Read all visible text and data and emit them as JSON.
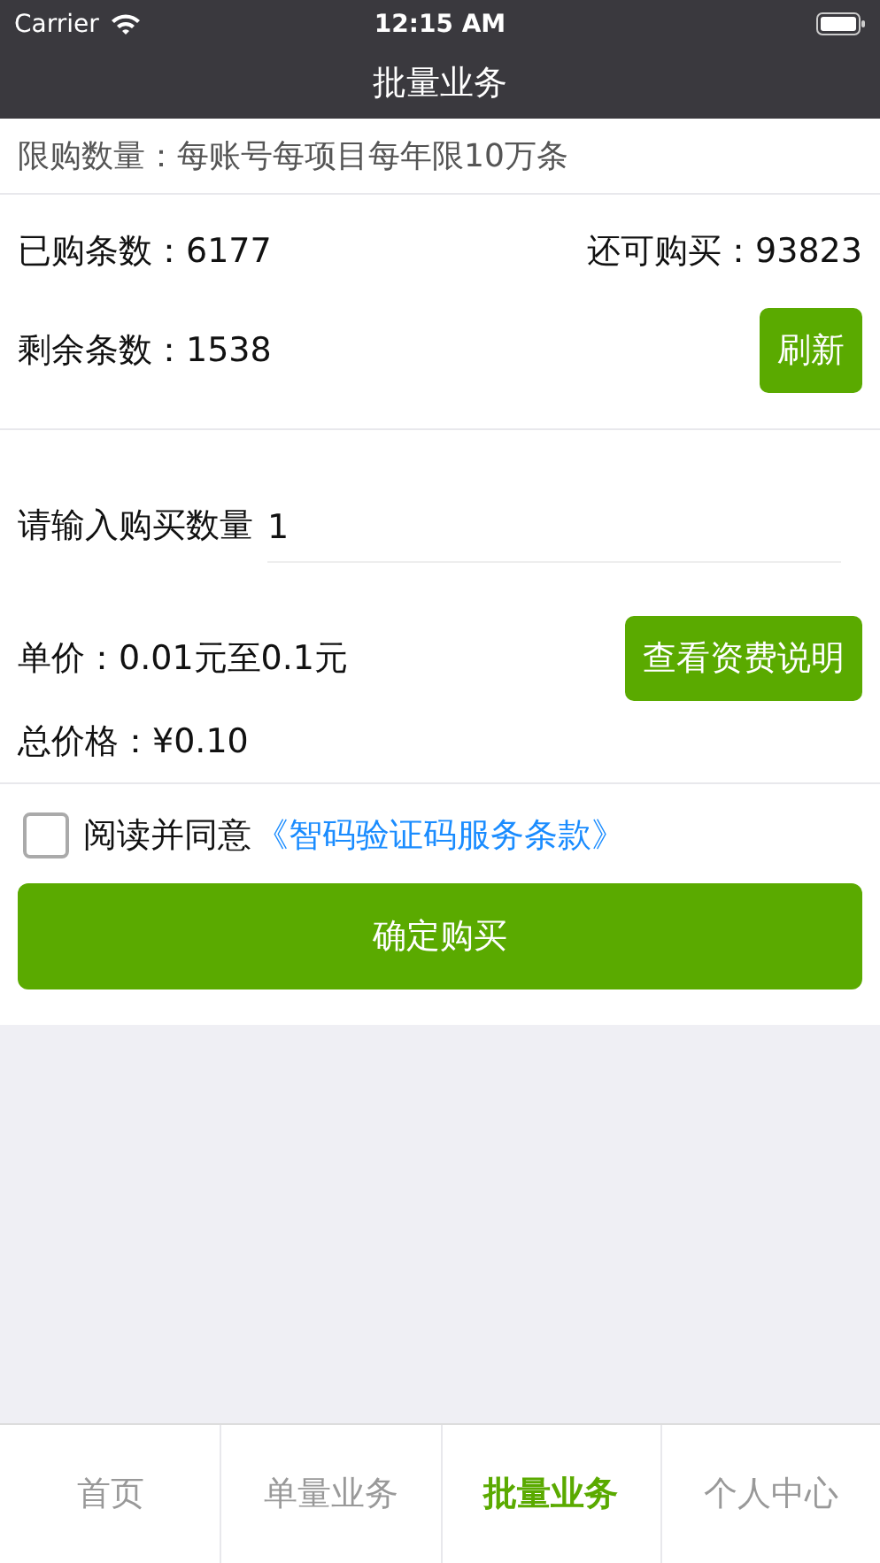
{
  "status_bar": {
    "carrier": "Carrier",
    "time": "12:15 AM"
  },
  "nav": {
    "title": "批量业务"
  },
  "limit": {
    "label": "限购数量：",
    "value": "每账号每项目每年限10万条"
  },
  "stats": {
    "purchased": {
      "label": "已购条数：",
      "value": "6177"
    },
    "available": {
      "label": "还可购买：",
      "value": "93823"
    },
    "remaining": {
      "label": "剩余条数：",
      "value": "1538"
    },
    "refresh_button": "刷新"
  },
  "quantity": {
    "label": "请输入购买数量",
    "value": "1"
  },
  "unit_price": {
    "label": "单价：",
    "value": "0.01元至0.1元"
  },
  "fee_button": "查看资费说明",
  "total": {
    "label": "总价格：",
    "value": "¥0.10"
  },
  "agreement": {
    "checked": false,
    "text": "阅读并同意",
    "link": "《智码验证码服务条款》"
  },
  "confirm_button": "确定购买",
  "tabs": [
    {
      "label": "首页",
      "selected": false
    },
    {
      "label": "单量业务",
      "selected": false
    },
    {
      "label": "批量业务",
      "selected": true
    },
    {
      "label": "个人中心",
      "selected": false
    }
  ]
}
